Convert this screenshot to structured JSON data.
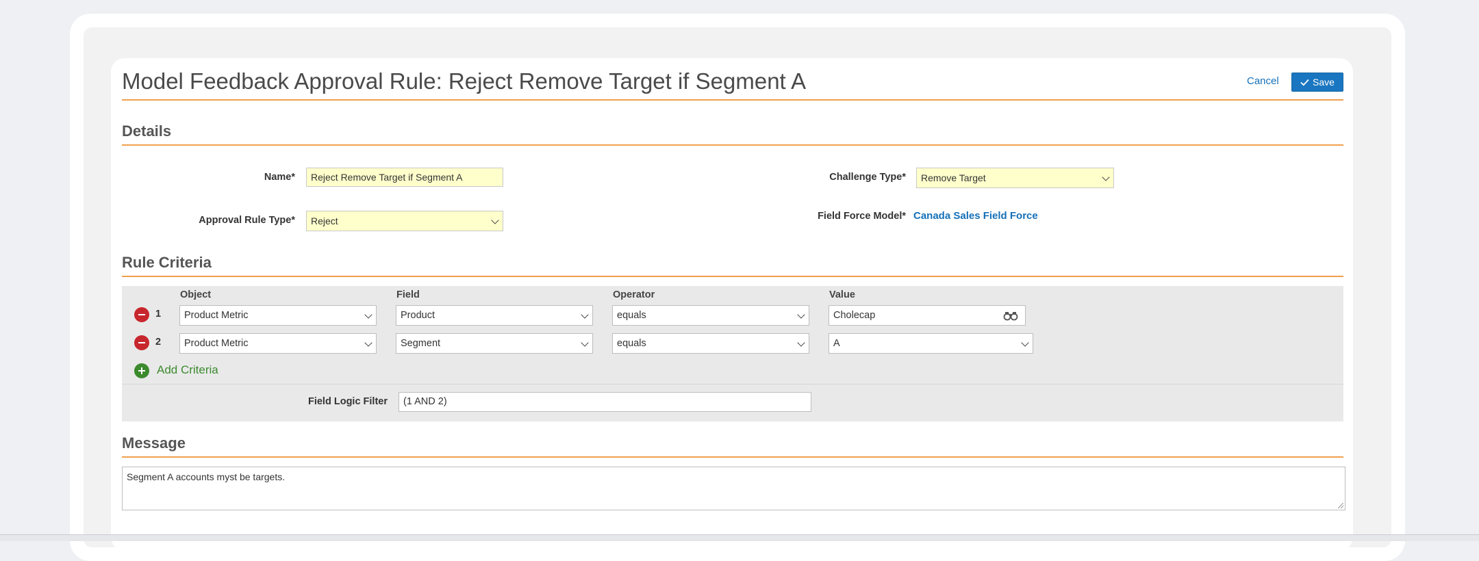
{
  "header": {
    "title": "Model Feedback Approval Rule: Reject Remove Target if Segment A",
    "cancel_label": "Cancel",
    "save_label": "Save"
  },
  "details": {
    "section_title": "Details",
    "name": {
      "label": "Name*",
      "value": "Reject Remove Target if Segment A"
    },
    "approval_rule_type": {
      "label": "Approval Rule Type*",
      "value": "Reject"
    },
    "challenge_type": {
      "label": "Challenge Type*",
      "value": "Remove Target"
    },
    "field_force_model": {
      "label": "Field Force Model*",
      "value": "Canada Sales Field Force"
    }
  },
  "rule_criteria": {
    "section_title": "Rule Criteria",
    "columns": [
      "Object",
      "Field",
      "Operator",
      "Value"
    ],
    "rows": [
      {
        "num": "1",
        "object": "Product Metric",
        "field": "Product",
        "operator": "equals",
        "value": "Cholecap"
      },
      {
        "num": "2",
        "object": "Product Metric",
        "field": "Segment",
        "operator": "equals",
        "value": "A"
      }
    ],
    "add_label": "Add Criteria",
    "logic_filter": {
      "label": "Field Logic Filter",
      "value": "(1 AND 2)"
    }
  },
  "message": {
    "section_title": "Message",
    "value": "Segment A accounts myst be targets."
  },
  "colors": {
    "accent_rule": "#f0a04b",
    "link": "#1570b8",
    "save_button": "#1a76c0",
    "required_field": "#ffffcc",
    "remove": "#c8262d",
    "add": "#3c8a2e"
  },
  "icons": [
    "checkmark-icon",
    "chevron-down-icon",
    "binoculars-icon",
    "remove-icon",
    "add-icon"
  ]
}
